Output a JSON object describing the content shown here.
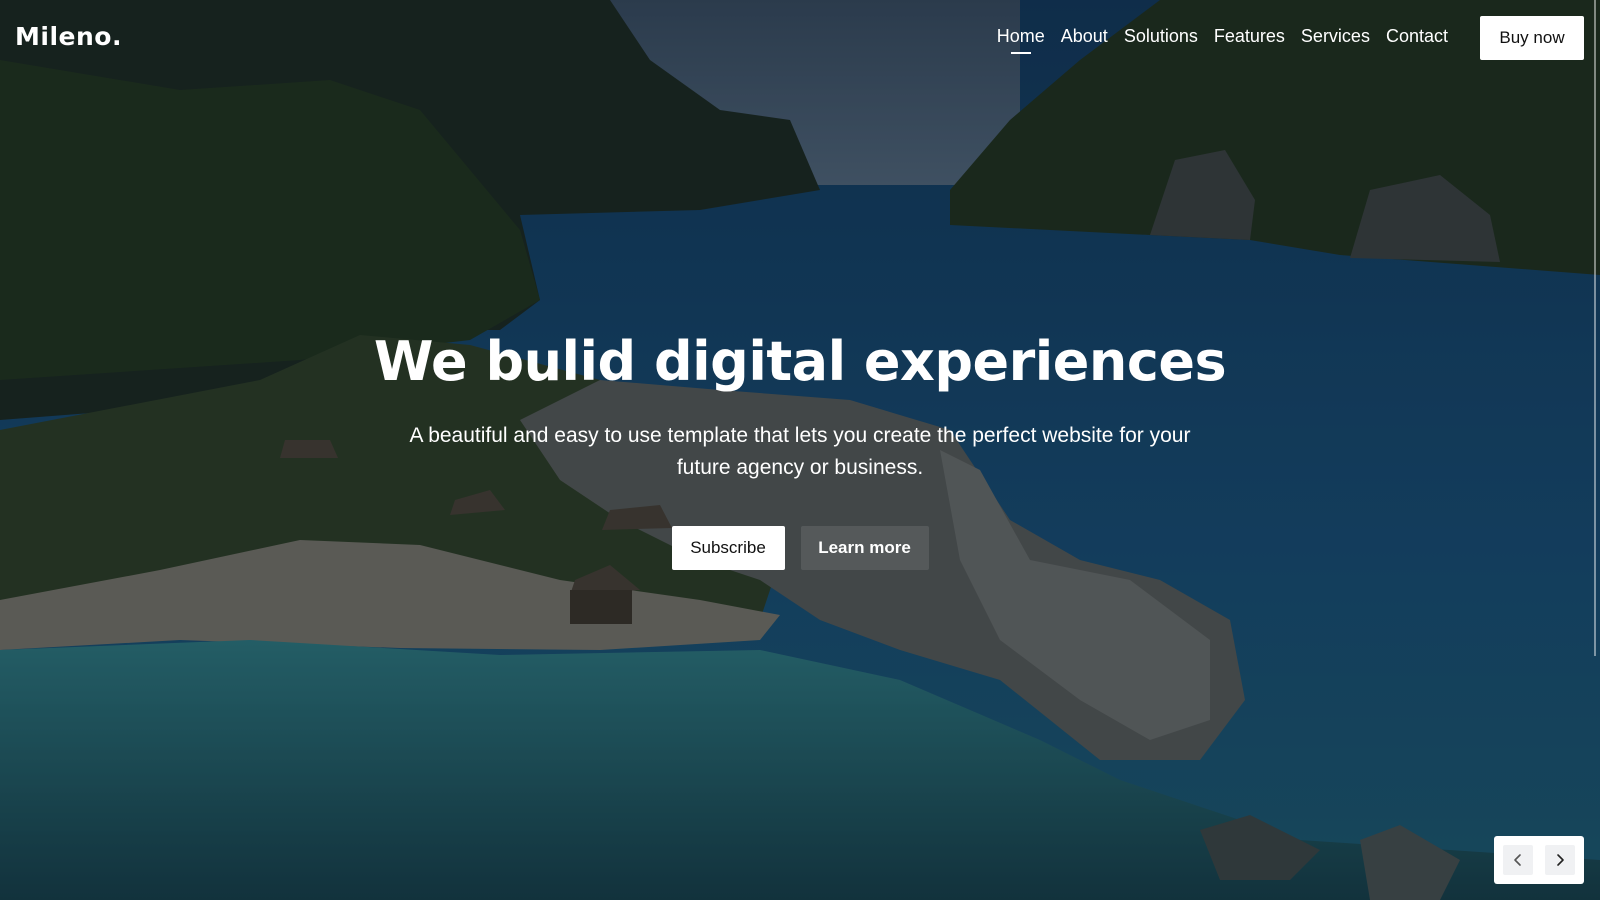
{
  "brand": "Mileno.",
  "nav": {
    "items": [
      {
        "label": "Home",
        "active": true
      },
      {
        "label": "About"
      },
      {
        "label": "Solutions"
      },
      {
        "label": "Features"
      },
      {
        "label": "Services"
      },
      {
        "label": "Contact"
      }
    ],
    "cta_label": "Buy now"
  },
  "hero": {
    "title": "We bulid digital experiences",
    "subtitle": "A beautiful and easy to use template that lets you create the perfect website for your future agency or business.",
    "primary_label": "Subscribe",
    "secondary_label": "Learn more"
  },
  "slider": {
    "prev_icon": "chevron-left-icon",
    "next_icon": "chevron-right-icon"
  },
  "colors": {
    "text": "#ffffff",
    "button_bg": "#ffffff",
    "button_text": "#111111"
  }
}
